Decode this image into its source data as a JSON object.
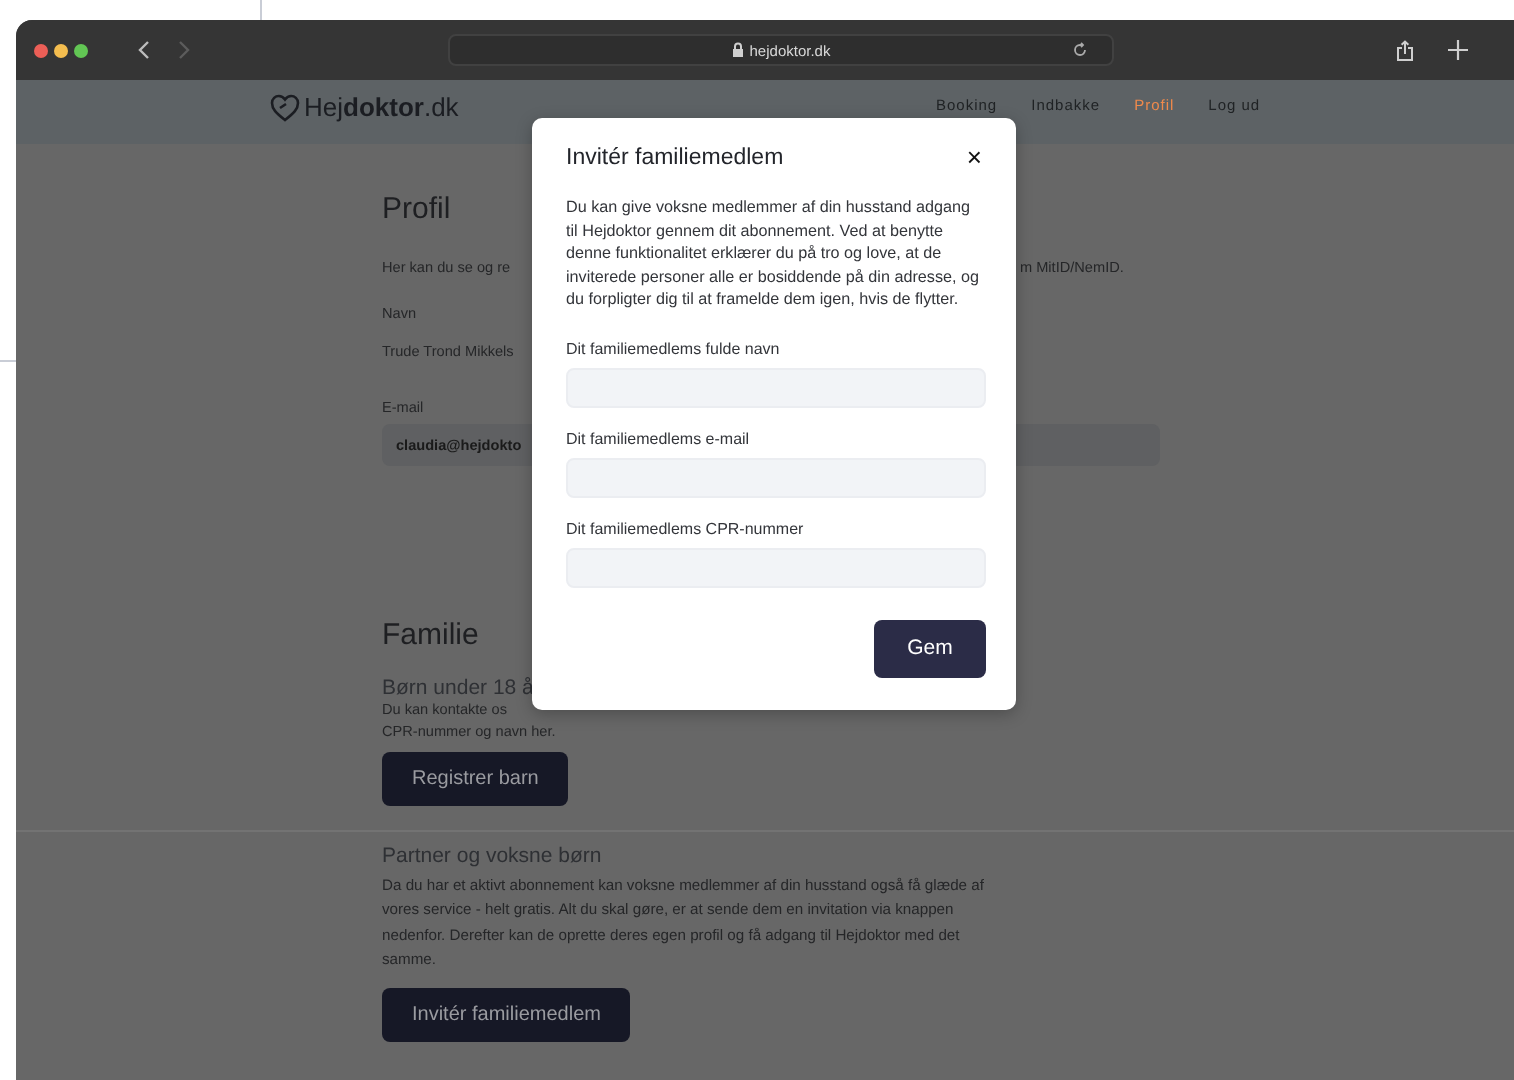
{
  "browser": {
    "url": "hejdoktor.dk"
  },
  "header": {
    "logo": "Hej**doktor**.dk",
    "nav": [
      {
        "label": "Booking",
        "selected": false
      },
      {
        "label": "Indbakke",
        "selected": false
      },
      {
        "label": "Profil",
        "selected": true
      },
      {
        "label": "Log ud",
        "selected": false
      }
    ]
  },
  "profile": {
    "title": "Profil",
    "intro_left": "Her kan du se og re",
    "intro_right": "m MitID/NemID.",
    "name_label": "Navn",
    "name_value": "Trude Trond Mikkels",
    "email_label": "E-mail",
    "email_value": "claudia@hejdokto"
  },
  "family": {
    "title": "Familie",
    "children_title": "Børn under 18 å",
    "children_text_1": "Du kan kontakte os",
    "children_text_2": "CPR-nummer og navn her.",
    "children_button": "Registrer barn",
    "adults_title": "Partner og voksne børn",
    "adults_text": "Da du har et aktivt abonnement kan voksne medlemmer af din husstand også få glæde af vores service - helt gratis. Alt du skal gøre, er at sende dem en invitation via knappen nedenfor. Derefter kan de oprette deres egen profil og få adgang til Hejdoktor med det samme.",
    "adults_button": "Invitér familiemedlem"
  },
  "modal": {
    "title": "Invitér familiemedlem",
    "close": "×",
    "text": "Du kan give voksne medlemmer af din husstand adgang til Hejdoktor gennem dit abonnement. Ved at benytte denne funktionalitet erklærer du på tro og love, at de inviterede personer alle er bosiddende på din adresse, og du forpligter dig til at framelde dem igen, hvis de flytter.",
    "fields": [
      {
        "label": "Dit familiemedlems fulde navn"
      },
      {
        "label": "Dit familiemedlems e-mail"
      },
      {
        "label": "Dit familiemedlems CPR-nummer"
      }
    ],
    "button": "Gem"
  }
}
